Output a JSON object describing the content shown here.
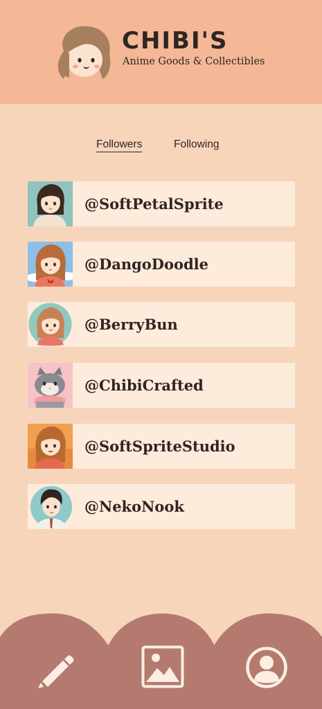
{
  "brand": {
    "title": "CHIBI'S",
    "subtitle": "Anime Goods & Collectibles"
  },
  "tabs": {
    "followers": "Followers",
    "following": "Following",
    "active": "followers"
  },
  "followers": [
    {
      "handle": "@SoftPetalSprite",
      "avatar": "girl-dark-hair-avatar"
    },
    {
      "handle": "@DangoDoodle",
      "avatar": "girl-sky-background-avatar"
    },
    {
      "handle": "@BerryBun",
      "avatar": "girl-circle-avatar"
    },
    {
      "handle": "@ChibiCrafted",
      "avatar": "cat-avatar"
    },
    {
      "handle": "@SoftSpriteStudio",
      "avatar": "girl-sunset-avatar"
    },
    {
      "handle": "@NekoNook",
      "avatar": "boy-avatar"
    }
  ],
  "nav": {
    "items": [
      "edit-pencil-icon",
      "image-icon",
      "profile-icon"
    ]
  },
  "colors": {
    "header": "#f4b896",
    "background": "#f7d5bb",
    "row": "#fdebdc",
    "nav": "#b47a70",
    "text": "#2f2522"
  }
}
